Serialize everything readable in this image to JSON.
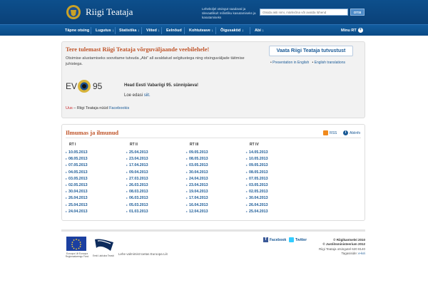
{
  "header": {
    "brand": "Riigi Teataja",
    "slogan": "Leheküljel otsingut saadaval ja ülevaatlikult mõistliku kasutamiseks ja kasutamiseks",
    "search_placeholder": "Otsida akti nimi, märksõna või avalda lühend",
    "search_button": "OTSI"
  },
  "nav": {
    "items": [
      "Täpne otsing",
      "Lugutus ↓",
      "Statistika ↓",
      "Viited ↓",
      "Eelnõud",
      "Kohtuteave ↓",
      "Õigusaktid ↓",
      "Abi ↓"
    ],
    "mini_rt": "Minu RT"
  },
  "welcome": {
    "title": "Tere tulemast Riigi Teataja võrguväljaande veebilehele!",
    "text": "Otsimise alustamiseks soovitame tutvuda „Abi“ all avaldatud selgitustega ning otsinguväljade täitmise juhistega.",
    "ev_prefix": "EV",
    "ev_num": "95",
    "ev_heading": "Head Eesti Vabariigi 95. sünnipäeva!",
    "ev_more_prefix": "Loe edasi",
    "ev_more_link": "siit.",
    "uus_label": "Uus",
    "uus_text": " – Riigi Teataja nüüd ",
    "uus_link": "Facebookis",
    "tour_button": "Vaata Riigi Teataja tutvustust",
    "lang_en": "Presentation in English",
    "lang_trans": "English translations"
  },
  "ilmumas": {
    "title": "Ilmumas ja ilmunud",
    "rss": "RSS",
    "help": "Abiinfo",
    "columns": [
      {
        "label": "RT I",
        "dates": [
          "10.05.2013",
          "08.05.2013",
          "07.05.2013",
          "04.05.2013",
          "03.05.2013",
          "02.05.2013",
          "30.04.2013",
          "26.04.2013",
          "25.04.2013",
          "24.04.2013"
        ]
      },
      {
        "label": "RT II",
        "dates": [
          "25.04.2013",
          "23.04.2013",
          "17.04.2013",
          "09.04.2013",
          "27.03.2013",
          "26.03.2013",
          "08.03.2013",
          "06.03.2013",
          "05.03.2013",
          "01.03.2013"
        ]
      },
      {
        "label": "RT III",
        "dates": [
          "09.05.2013",
          "08.05.2013",
          "03.05.2013",
          "30.04.2013",
          "24.04.2013",
          "23.04.2013",
          "19.04.2013",
          "17.04.2013",
          "16.04.2013",
          "12.04.2013"
        ]
      },
      {
        "label": "RT IV",
        "dates": [
          "14.05.2013",
          "10.05.2013",
          "09.05.2013",
          "08.05.2013",
          "07.05.2013",
          "03.05.2013",
          "02.05.2013",
          "30.04.2013",
          "26.04.2013",
          "25.04.2013"
        ]
      }
    ]
  },
  "footer": {
    "eu_text": "Euroopa Liit Euroopa Regionaalarengu Fond",
    "elogo_text": "Eesti Lakkuba Teaski",
    "cofund": "Lehe valmimist toetas Euroopa Liit",
    "facebook": "Facebook",
    "twitter": "Twitter",
    "copy1": "© Riigikantselei 2010",
    "copy2": "© Justiitsministeerium 2012",
    "copy3": "Riigi Teataja otsingutel 620 8140",
    "copy4_prefix": "Tagasiside:",
    "copy4_link": "e-kiri"
  }
}
